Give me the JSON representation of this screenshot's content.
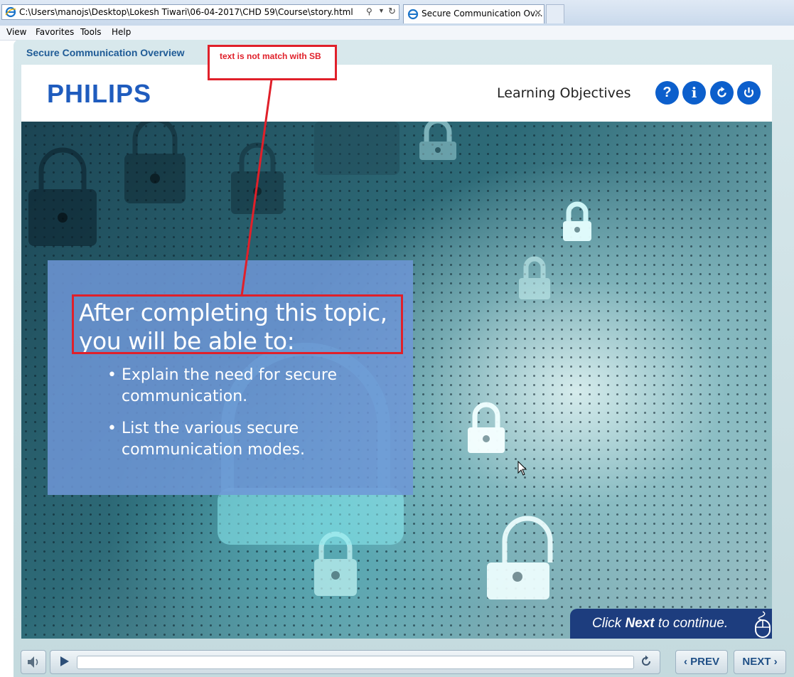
{
  "browser": {
    "address": "C:\\Users\\manojs\\Desktop\\Lokesh Tiwari\\06-04-2017\\CHD 59\\Course\\story.html",
    "tab_title": "Secure Communication Ov...",
    "menu": [
      "View",
      "Favorites",
      "Tools",
      "Help"
    ]
  },
  "player": {
    "course_title": "Secure Communication Overview",
    "brand": "PHILIPS",
    "slide_title": "Learning Objectives",
    "header_buttons": [
      {
        "icon": "help-icon",
        "glyph": "?"
      },
      {
        "icon": "info-icon",
        "glyph": "i"
      },
      {
        "icon": "replay-icon"
      },
      {
        "icon": "power-icon"
      }
    ],
    "prev_label": "PREV",
    "next_label": "NEXT"
  },
  "slide": {
    "heading": "After completing this topic, you will be able to:",
    "bullets": [
      "Explain the need for secure communication.",
      "List the various secure communication modes."
    ],
    "continue": {
      "prefix": "Click ",
      "emphasis": "Next",
      "suffix": " to continue."
    }
  },
  "annotation": {
    "text": "text is not match with SB",
    "color": "#e0202a"
  },
  "colors": {
    "brand_blue": "#1f5cbe",
    "header_button": "#0c5fcc",
    "content_box": "#6e96d7",
    "continue_panel": "#1d3d7e"
  }
}
